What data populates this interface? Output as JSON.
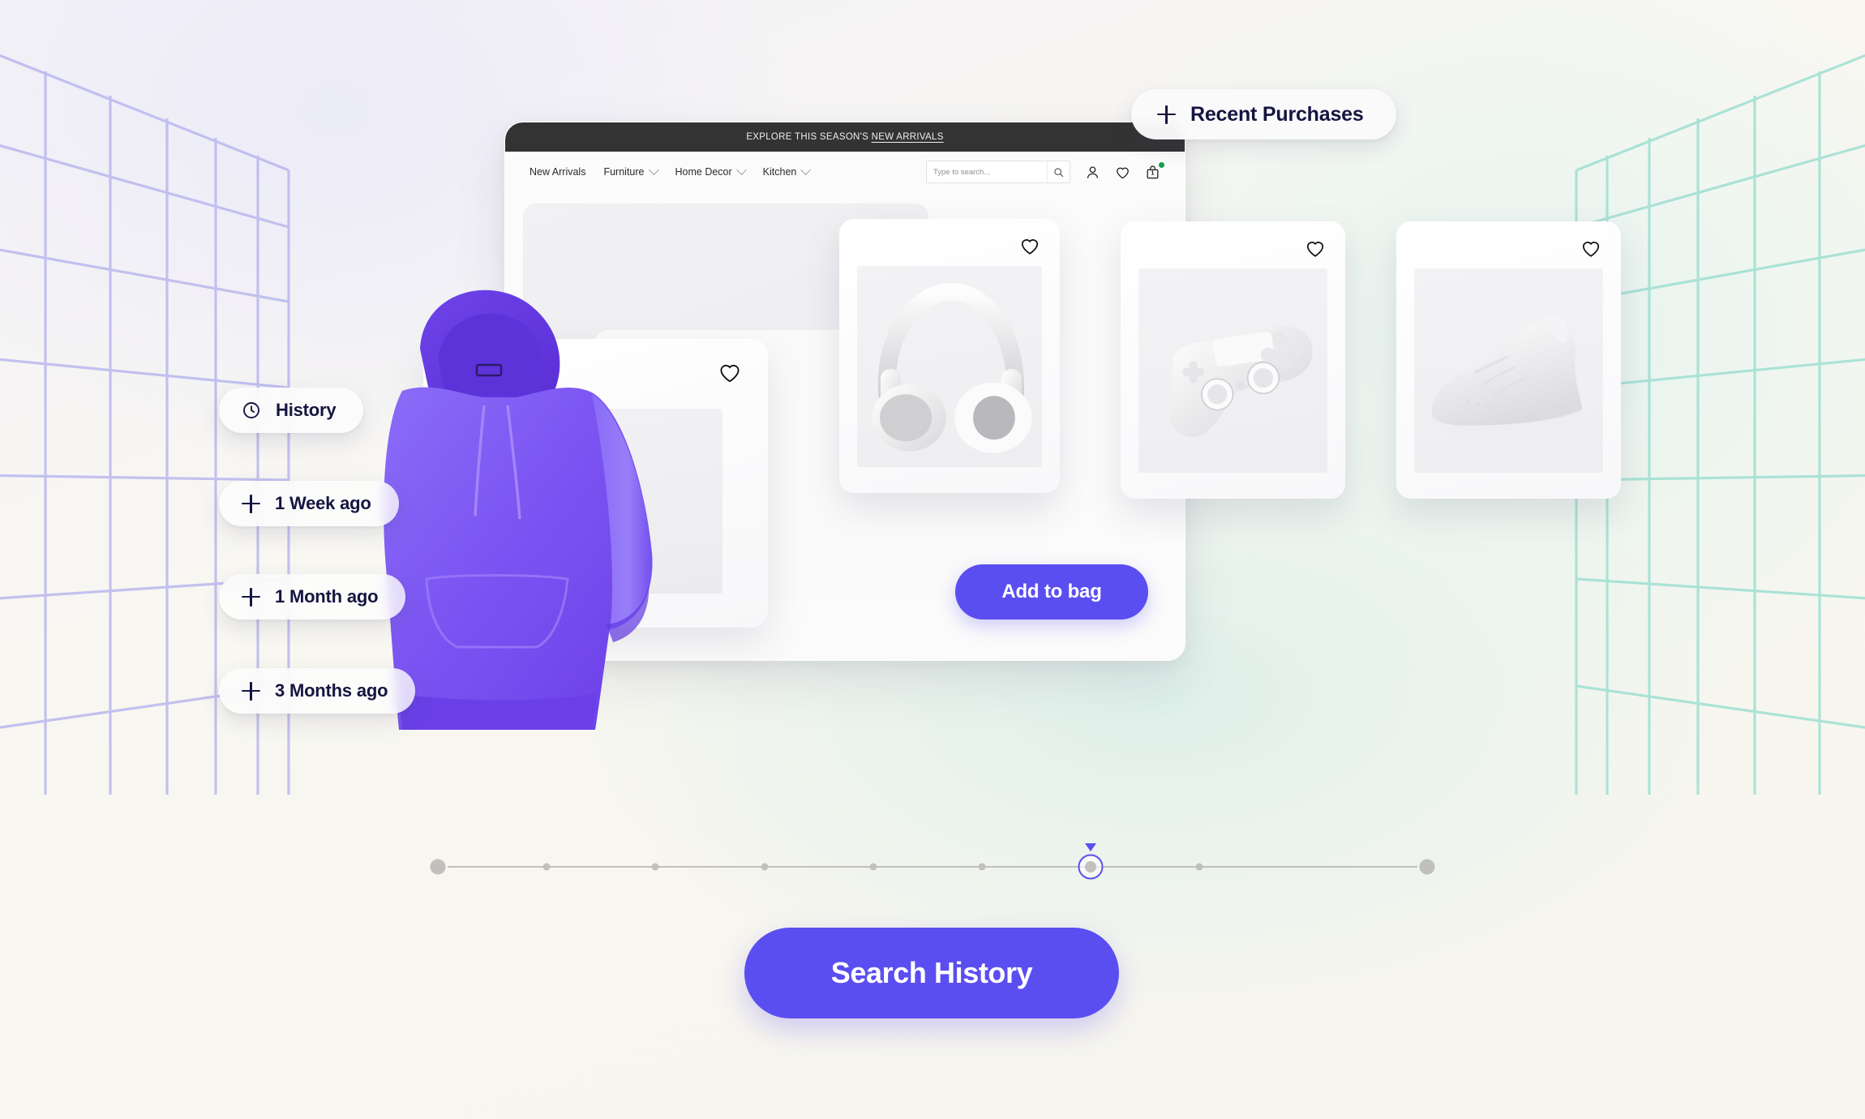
{
  "background": {
    "grid_left_color": "#b9b8ee",
    "grid_right_color": "#9fdfd2",
    "accent_purple": "#5b4ef0",
    "banner_dark": "#333333"
  },
  "browser": {
    "banner": {
      "prefix": "EXPLORE THIS SEASON'S ",
      "link": "NEW ARRIVALS"
    },
    "nav": {
      "links": [
        {
          "label": "New Arrivals",
          "has_chevron": false
        },
        {
          "label": "Furniture",
          "has_chevron": true
        },
        {
          "label": "Home Decor",
          "has_chevron": true
        },
        {
          "label": "Kitchen",
          "has_chevron": true
        }
      ],
      "search": {
        "placeholder": "Type to search...",
        "value": "",
        "icon": "search-icon"
      },
      "icons": [
        {
          "name": "account-icon"
        },
        {
          "name": "wishlist-heart-icon"
        },
        {
          "name": "shopping-bag-icon",
          "badge": "1",
          "status_dot": true
        }
      ]
    }
  },
  "chips": {
    "recent_purchases": {
      "label": "Recent Purchases",
      "icon": "plus-icon"
    },
    "history_header": {
      "label": "History",
      "icon": "clock-icon"
    },
    "history_items": [
      {
        "label": "1 Week ago",
        "icon": "plus-icon"
      },
      {
        "label": "1 Month ago",
        "icon": "plus-icon"
      },
      {
        "label": "3 Months ago",
        "icon": "plus-icon"
      }
    ]
  },
  "products": [
    {
      "name": "hoodie",
      "favorite_icon": "heart-icon",
      "favorited": false
    },
    {
      "name": "headphones",
      "favorite_icon": "heart-icon",
      "favorited": false
    },
    {
      "name": "game-controller",
      "favorite_icon": "heart-icon",
      "favorited": false
    },
    {
      "name": "sneaker",
      "favorite_icon": "heart-icon",
      "favorited": false
    }
  ],
  "buttons": {
    "add_to_bag": "Add to bag",
    "search_history": "Search History"
  },
  "timeline": {
    "total_nodes": 9,
    "selected_index": 6,
    "node_positions_pct": [
      0,
      11,
      22,
      33,
      44,
      55,
      66,
      77,
      100
    ],
    "node_types": [
      "end",
      "small",
      "small",
      "small",
      "small",
      "small",
      "selected",
      "small",
      "end"
    ]
  }
}
